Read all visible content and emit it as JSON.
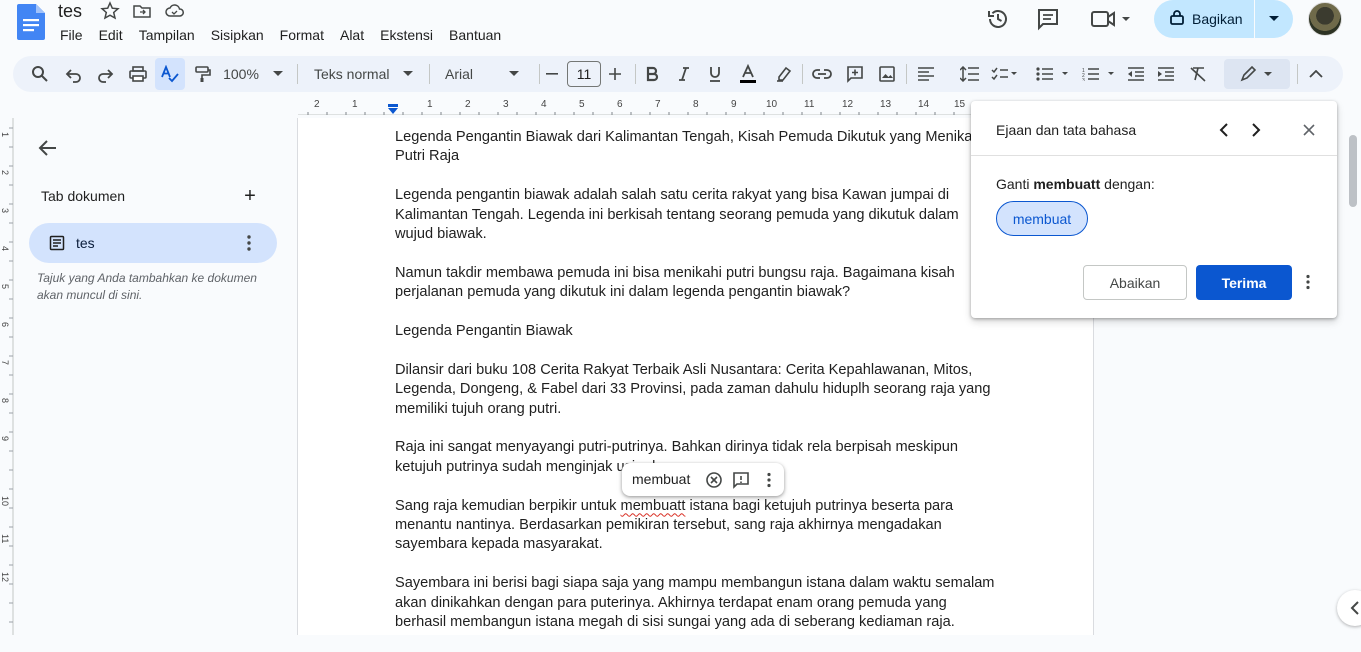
{
  "app": {
    "doc_title": "tes",
    "menu": [
      "File",
      "Edit",
      "Tampilan",
      "Sisipkan",
      "Format",
      "Alat",
      "Ekstensi",
      "Bantuan"
    ],
    "share_label": "Bagikan",
    "brand_color": "#1a73e8",
    "share_bg": "#c2e7ff"
  },
  "toolbar": {
    "zoom": "100%",
    "style": "Teks normal",
    "font": "Arial",
    "font_size": "11",
    "icons": [
      "search-icon",
      "undo-icon",
      "redo-icon",
      "print-icon",
      "spellcheck-icon",
      "paint-format-icon",
      "bold-icon",
      "italic-icon",
      "underline-icon",
      "text-color-icon",
      "highlight-icon",
      "link-icon",
      "comment-add-icon",
      "image-icon",
      "align-icon",
      "line-spacing-icon",
      "checklist-icon",
      "bullet-list-icon",
      "numbered-list-icon",
      "indent-decrease-icon",
      "indent-increase-icon",
      "clear-format-icon",
      "edit-mode-icon",
      "collapse-icon"
    ]
  },
  "ruler": {
    "marks": [
      "2",
      "1",
      "1",
      "2",
      "3",
      "4",
      "5",
      "6",
      "7",
      "8",
      "9",
      "10",
      "11",
      "12",
      "13",
      "14",
      "15"
    ],
    "vmarks": [
      "1",
      "2",
      "3",
      "4",
      "5",
      "6",
      "7",
      "8",
      "9",
      "10",
      "11",
      "12"
    ]
  },
  "sidebar": {
    "heading": "Tab dokumen",
    "add_symbol": "+",
    "tab_label": "tes",
    "hint": "Tajuk yang Anda tambahkan ke dokumen akan muncul di sini."
  },
  "document": {
    "paragraphs": [
      "Legenda Pengantin Biawak dari Kalimantan Tengah, Kisah Pemuda Dikutuk yang Menikahi Putri Raja",
      "Legenda pengantin biawak adalah salah satu cerita rakyat yang bisa Kawan jumpai di Kalimantan Tengah. Legenda ini berkisah tentang seorang pemuda yang dikutuk dalam wujud biawak.",
      "Namun takdir membawa pemuda ini bisa menikahi putri bungsu raja. Bagaimana kisah perjalanan pemuda yang dikutuk ini dalam legenda pengantin biawak?",
      "Legenda Pengantin Biawak",
      "Dilansir dari buku 108 Cerita Rakyat Terbaik Asli Nusantara: Cerita Kepahlawanan, Mitos, Legenda, Dongeng, & Fabel dari 33 Provinsi, pada zaman dahulu hiduplh seorang raja yang memiliki tujuh orang putri.",
      "Raja ini sangat menyayangi putri-putrinya. Bahkan dirinya tidak rela berpisah meskipun ketujuh putrinya sudah menginjak usia dewasa.",
      "Sang raja kemudian berpikir untuk membuatt istana bagi ketujuh putrinya beserta para menantu nantinya. Berdasarkan pemikiran tersebut, sang raja akhirnya mengadakan sayembara kepada masyarakat.",
      "Sayembara ini berisi bagi siapa saja yang mampu membangun istana dalam waktu semalam akan dinikahkan dengan para puterinya. Akhirnya terdapat enam orang pemuda yang berhasil membangun istana megah di sisi sungai yang ada di seberang kediaman raja."
    ],
    "misspelled_word": "membuatt"
  },
  "inline_suggestion": {
    "word": "membuat"
  },
  "spell_panel": {
    "title": "Ejaan dan tata bahasa",
    "instruction_prefix": "Ganti",
    "instruction_word": "membuatt",
    "instruction_suffix": "dengan:",
    "suggestion": "membuat",
    "ignore_label": "Abaikan",
    "accept_label": "Terima",
    "accent": "#0b57d0"
  }
}
